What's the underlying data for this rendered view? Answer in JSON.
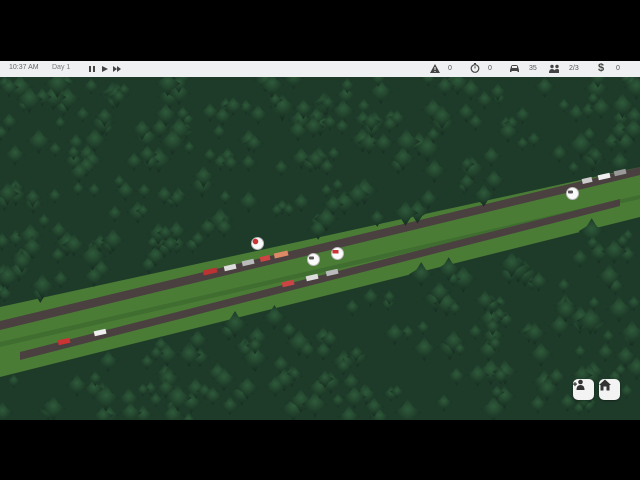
{
  "hud": {
    "time": "10:37 AM",
    "day": "Day 1",
    "stats": {
      "incidents": "0",
      "timer": "0",
      "vehicles": "35",
      "people": "2/3",
      "money": "0"
    }
  },
  "icons": {
    "pause": "pause-icon",
    "play": "play-icon",
    "fast_forward": "fast-forward-icon",
    "warning": "warning-icon",
    "stopwatch": "stopwatch-icon",
    "car": "car-icon",
    "people": "people-icon",
    "dollar": "dollar-icon",
    "add_unit": "add-person-icon",
    "home": "home-icon"
  },
  "colors": {
    "hud_bg": "#eef0f1",
    "grass": "#3c6e2f",
    "forest": "#1f3d2a",
    "road": "#4a4040"
  }
}
